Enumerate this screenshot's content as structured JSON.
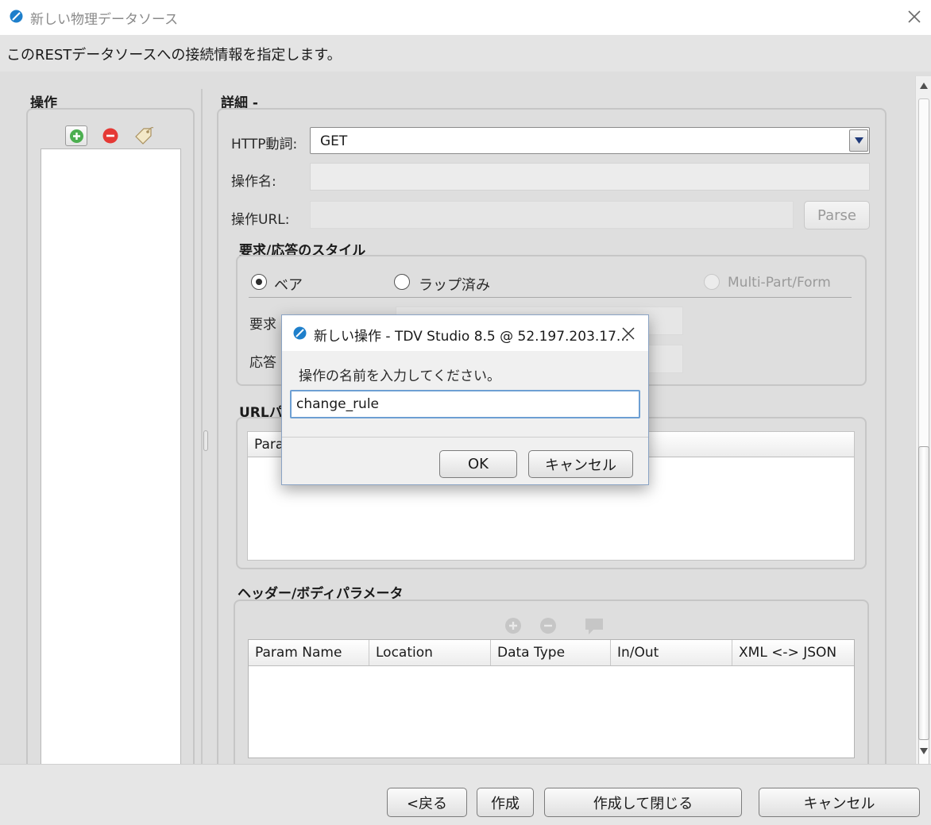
{
  "window": {
    "title": "新しい物理データソース",
    "subtitle": "このRESTデータソースへの接続情報を指定します。"
  },
  "operations": {
    "heading": "操作"
  },
  "details": {
    "heading": "詳細 -",
    "http_verb_label": "HTTP動詞:",
    "http_verb_value": "GET",
    "operation_name_label": "操作名:",
    "operation_url_label": "操作URL:",
    "parse_button": "Parse"
  },
  "style_section": {
    "heading": "要求/応答のスタイル",
    "options": [
      "ベア",
      "ラップ済み",
      "Multi-Part/Form"
    ],
    "selected": "ベア",
    "request_label": "要求",
    "response_label": "応答"
  },
  "url_params": {
    "heading": "URLパ",
    "header_partial": "Para"
  },
  "header_body_params": {
    "heading": "ヘッダー/ボディパラメータ",
    "columns": [
      "Param Name",
      "Location",
      "Data Type",
      "In/Out",
      "XML <-> JSON"
    ]
  },
  "footer": {
    "back": "<戻る",
    "create": "作成",
    "create_close": "作成して閉じる",
    "cancel": "キャンセル"
  },
  "dialog": {
    "title": "新しい操作 - TDV Studio 8.5 @ 52.197.203.17...",
    "prompt": "操作の名前を入力してください。",
    "input_value": "change_rule",
    "ok": "OK",
    "cancel": "キャンセル"
  },
  "colors": {
    "accent": "#1e7fcb",
    "add_icon": "#4caf50",
    "remove_icon": "#e53935"
  }
}
